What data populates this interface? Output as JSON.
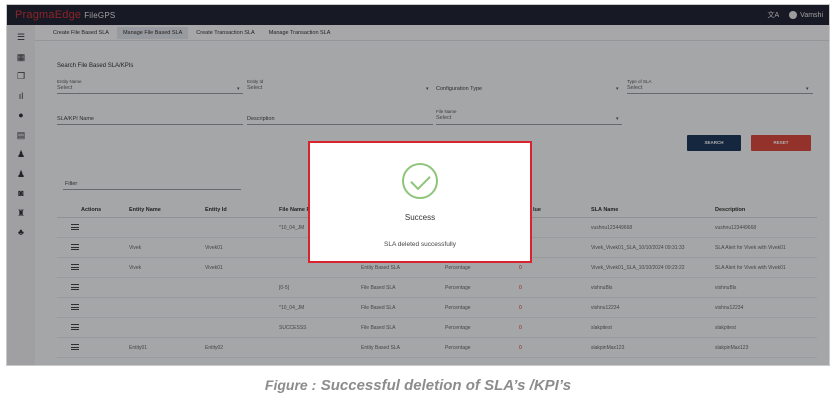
{
  "app": {
    "logo": "PragmaEdge",
    "name": "FileGPS",
    "user": "Vamshi",
    "translate_icon": "translate-icon",
    "user_icon": "account-icon"
  },
  "sidebar": {
    "icons": [
      "menu-icon",
      "dashboard-icon",
      "copy-icon",
      "bar-chart-icon",
      "account-circle-icon",
      "document-icon",
      "bell-icon",
      "alert-icon",
      "history-icon",
      "hierarchy-icon",
      "people-icon"
    ]
  },
  "tabs": [
    {
      "label": "Create File Based SLA"
    },
    {
      "label": "Manage File Based SLA"
    },
    {
      "label": "Create Transaction SLA"
    },
    {
      "label": "Manage Transaction SLA"
    }
  ],
  "search": {
    "title": "Search File Based SLA/KPIs",
    "entity_name": {
      "label": "Entity Name",
      "value": "Select"
    },
    "entity_id": {
      "label": "Entity Id",
      "value": "Select"
    },
    "configuration_type": {
      "label": "Configuration Type"
    },
    "type_of_sla": {
      "label": "Type of SLA",
      "value": "Select"
    },
    "sla_kpi_name": {
      "label": "SLA/KPI Name"
    },
    "description": {
      "label": "Description"
    },
    "file_name": {
      "label": "File Name",
      "value": "Select"
    },
    "search_button": "SEARCH",
    "reset_button": "RESET"
  },
  "filter": {
    "label": "Filter"
  },
  "table": {
    "headers": [
      "Actions",
      "Entity Name",
      "Entity Id",
      "File Name Pa",
      "",
      "",
      "lue",
      "SLA Name",
      "Description"
    ],
    "rows": [
      {
        "entity_name": "",
        "entity_id": "",
        "file_name": "*10_04_JM",
        "config": "",
        "type": "",
        "value": "",
        "sla_name": "vushnu123449668",
        "description": "vushnu123449668"
      },
      {
        "entity_name": "Vivek",
        "entity_id": "Vivek01",
        "file_name": "",
        "config": "",
        "type": "",
        "value": "",
        "sla_name": "Vivek_Vivek01_SLA_10/10/2024 09:31:33",
        "description": "SLA Alert for Vivek with Vivek01"
      },
      {
        "entity_name": "Vivek",
        "entity_id": "Vivek01",
        "file_name": "",
        "config": "Entity Based SLA",
        "type": "Percentage",
        "value": "0",
        "sla_name": "Vivek_Vivek01_SLA_10/10/2024 09:23:22",
        "description": "SLA Alert for Vivek with Vivek01"
      },
      {
        "entity_name": "",
        "entity_id": "",
        "file_name": "[0-5]",
        "config": "File Based SLA",
        "type": "Percentage",
        "value": "0",
        "sla_name": "vishnuBls",
        "description": "vishnuBls"
      },
      {
        "entity_name": "",
        "entity_id": "",
        "file_name": "*10_04_JM",
        "config": "File Based SLA",
        "type": "Percentage",
        "value": "0",
        "sla_name": "vishnu12234",
        "description": "vishnu12234"
      },
      {
        "entity_name": "",
        "entity_id": "",
        "file_name": "SUCCESSS",
        "config": "File Based SLA",
        "type": "Percentage",
        "value": "0",
        "sla_name": "slakpitest",
        "description": "slakpitest"
      },
      {
        "entity_name": "Entity01",
        "entity_id": "Entity02",
        "file_name": "",
        "config": "Entity Based SLA",
        "type": "Percentage",
        "value": "0",
        "sla_name": "slakpinMax123",
        "description": "slakpinMax123"
      }
    ]
  },
  "dialog": {
    "title": "Success",
    "message": "SLA deleted successfully",
    "icon": "check-circle-icon",
    "accent": "#8ec57a",
    "border": "#d9242f"
  },
  "caption": {
    "prefix": "Figure :",
    "text": "Successful deletion of SLA’s /KPI’s"
  }
}
